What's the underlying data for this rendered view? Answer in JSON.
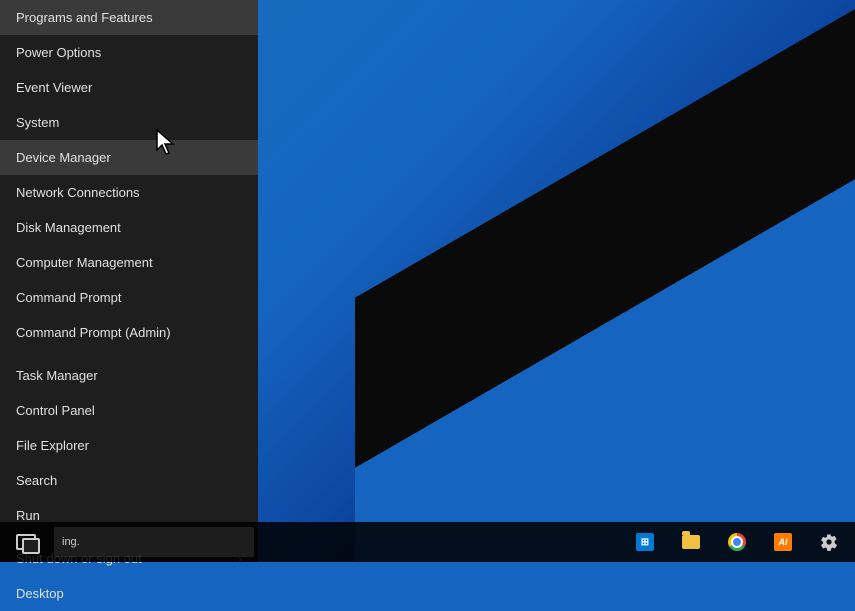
{
  "desktop": {
    "background": "#1565c0"
  },
  "menu": {
    "items": [
      {
        "id": "programs-features",
        "label": "Programs and Features",
        "divider_after": false,
        "has_arrow": false
      },
      {
        "id": "power-options",
        "label": "Power Options",
        "divider_after": false,
        "has_arrow": false
      },
      {
        "id": "event-viewer",
        "label": "Event Viewer",
        "divider_after": false,
        "has_arrow": false
      },
      {
        "id": "system",
        "label": "System",
        "divider_after": false,
        "has_arrow": false
      },
      {
        "id": "device-manager",
        "label": "Device Manager",
        "active": true,
        "divider_after": false,
        "has_arrow": false
      },
      {
        "id": "network-connections",
        "label": "Network Connections",
        "divider_after": false,
        "has_arrow": false
      },
      {
        "id": "disk-management",
        "label": "Disk Management",
        "divider_after": false,
        "has_arrow": false
      },
      {
        "id": "computer-management",
        "label": "Computer Management",
        "divider_after": false,
        "has_arrow": false
      },
      {
        "id": "command-prompt",
        "label": "Command Prompt",
        "divider_after": false,
        "has_arrow": false
      },
      {
        "id": "command-prompt-admin",
        "label": "Command Prompt (Admin)",
        "divider_after": true,
        "has_arrow": false
      },
      {
        "id": "task-manager",
        "label": "Task Manager",
        "divider_after": false,
        "has_arrow": false
      },
      {
        "id": "control-panel",
        "label": "Control Panel",
        "divider_after": false,
        "has_arrow": false
      },
      {
        "id": "file-explorer",
        "label": "File Explorer",
        "divider_after": false,
        "has_arrow": false
      },
      {
        "id": "search",
        "label": "Search",
        "divider_after": false,
        "has_arrow": false
      },
      {
        "id": "run",
        "label": "Run",
        "divider_after": true,
        "has_arrow": false
      },
      {
        "id": "shut-down",
        "label": "Shut down or sign out",
        "divider_after": false,
        "has_arrow": true
      },
      {
        "id": "desktop",
        "label": "Desktop",
        "divider_after": false,
        "has_arrow": false
      }
    ]
  },
  "taskbar": {
    "search_placeholder": "ing.",
    "icons": [
      {
        "id": "task-view",
        "label": "Task View"
      },
      {
        "id": "store",
        "label": "Microsoft Store"
      },
      {
        "id": "explorer",
        "label": "File Explorer"
      },
      {
        "id": "chrome",
        "label": "Google Chrome"
      },
      {
        "id": "ai",
        "label": "Adobe Illustrator"
      },
      {
        "id": "settings",
        "label": "Settings"
      }
    ]
  }
}
